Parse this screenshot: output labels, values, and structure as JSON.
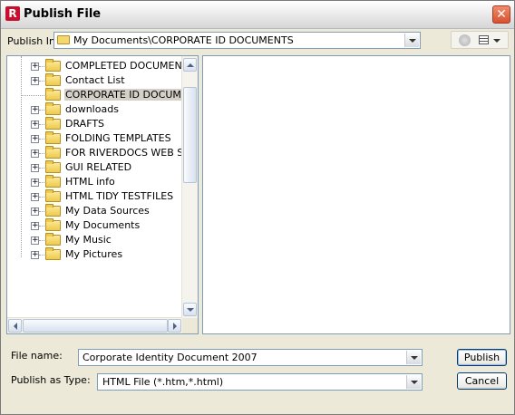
{
  "window": {
    "title": "Publish File",
    "app_icon_letter": "R"
  },
  "publish_in": {
    "label": "Publish In:",
    "value": "My Documents\\CORPORATE ID DOCUMENTS"
  },
  "tree": {
    "nodes": [
      {
        "label": "COMPLETED DOCUMENT",
        "expandable": true,
        "selected": false
      },
      {
        "label": "Contact List",
        "expandable": true,
        "selected": false
      },
      {
        "label": "CORPORATE ID DOCUME",
        "expandable": false,
        "selected": true
      },
      {
        "label": "downloads",
        "expandable": true,
        "selected": false
      },
      {
        "label": "DRAFTS",
        "expandable": true,
        "selected": false
      },
      {
        "label": "FOLDING TEMPLATES",
        "expandable": true,
        "selected": false
      },
      {
        "label": "FOR RIVERDOCS WEB SI",
        "expandable": true,
        "selected": false
      },
      {
        "label": "GUI RELATED",
        "expandable": true,
        "selected": false
      },
      {
        "label": "HTML info",
        "expandable": true,
        "selected": false
      },
      {
        "label": "HTML TIDY TESTFILES",
        "expandable": true,
        "selected": false
      },
      {
        "label": "My Data Sources",
        "expandable": true,
        "selected": false
      },
      {
        "label": "My Documents",
        "expandable": true,
        "selected": false
      },
      {
        "label": "My Music",
        "expandable": true,
        "selected": false
      },
      {
        "label": "My Pictures",
        "expandable": true,
        "selected": false
      }
    ],
    "expander_glyph": "+"
  },
  "file_name": {
    "label": "File name:",
    "value": "Corporate Identity Document 2007"
  },
  "publish_as_type": {
    "label": "Publish as Type:",
    "value": "HTML File (*.htm,*.html)"
  },
  "buttons": {
    "publish": "Publish",
    "cancel": "Cancel"
  },
  "title_close_glyph": "✕",
  "colors": {
    "selection": "#d4d0c8",
    "border": "#7f9db9",
    "app_icon": "#c8102e"
  }
}
